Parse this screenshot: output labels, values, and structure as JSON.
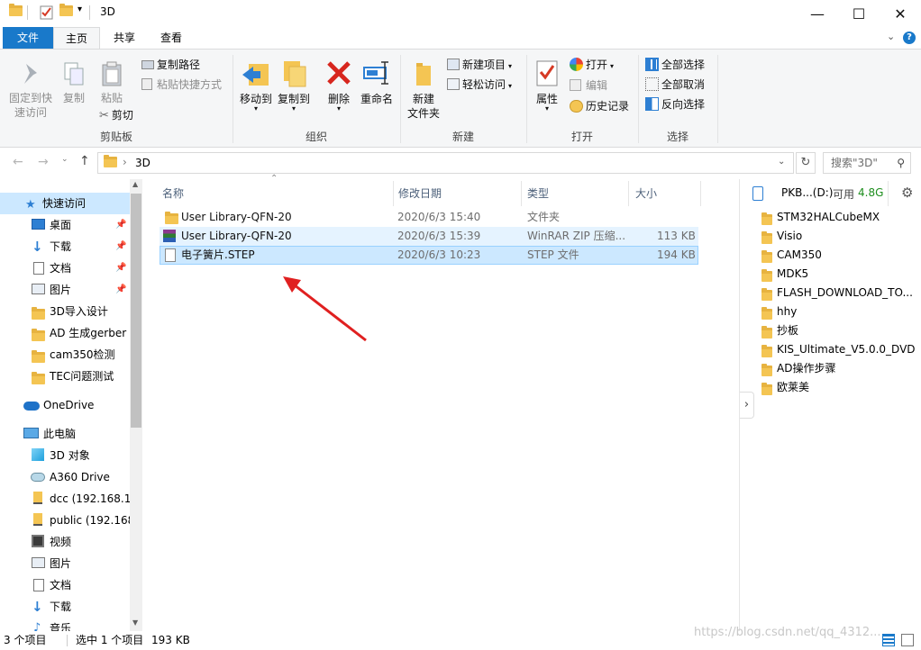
{
  "window": {
    "title": "3D",
    "minimize": "—",
    "maximize": "☐",
    "close": "✕"
  },
  "ribbon_tabs": [
    {
      "label": "文件"
    },
    {
      "label": "主页"
    },
    {
      "label": "共享"
    },
    {
      "label": "查看"
    }
  ],
  "ribbon": {
    "clipboard": {
      "pin_quick": "固定到快\n速访问",
      "copy": "复制",
      "paste": "粘贴",
      "copy_path": "复制路径",
      "paste_shortcut": "粘贴快捷方式",
      "cut": "剪切",
      "label": "剪贴板"
    },
    "organize": {
      "move_to": "移动到",
      "copy_to": "复制到",
      "delete": "删除",
      "rename": "重命名",
      "label": "组织"
    },
    "new": {
      "new_folder": "新建\n文件夹",
      "new_item": "新建项目",
      "easy_access": "轻松访问",
      "label": "新建"
    },
    "open": {
      "properties": "属性",
      "open": "打开",
      "edit": "编辑",
      "history": "历史记录",
      "label": "打开"
    },
    "select": {
      "select_all": "全部选择",
      "select_none": "全部取消",
      "invert": "反向选择",
      "label": "选择"
    }
  },
  "address": {
    "path": "3D",
    "search_placeholder": "搜索\"3D\""
  },
  "nav": {
    "items": [
      {
        "label": "快速访问",
        "icon": "star-icon"
      },
      {
        "label": "桌面",
        "icon": "desktop-icon",
        "pinned": true
      },
      {
        "label": "下载",
        "icon": "download-icon",
        "pinned": true
      },
      {
        "label": "文档",
        "icon": "document-icon",
        "pinned": true
      },
      {
        "label": "图片",
        "icon": "picture-icon",
        "pinned": true
      },
      {
        "label": "3D导入设计",
        "icon": "folder-icon"
      },
      {
        "label": "AD 生成gerber",
        "icon": "folder-icon"
      },
      {
        "label": "cam350检测",
        "icon": "folder-icon"
      },
      {
        "label": "TEC问题测试",
        "icon": "folder-icon"
      },
      {
        "label": "OneDrive",
        "icon": "cloud-icon"
      },
      {
        "label": "此电脑",
        "icon": "computer-icon"
      },
      {
        "label": "3D 对象",
        "icon": "cube-icon"
      },
      {
        "label": "A360 Drive",
        "icon": "drive-icon"
      },
      {
        "label": "dcc (192.168.1.",
        "icon": "network-folder-icon"
      },
      {
        "label": "public (192.168",
        "icon": "network-folder-icon"
      },
      {
        "label": "视频",
        "icon": "video-icon"
      },
      {
        "label": "图片",
        "icon": "picture-icon"
      },
      {
        "label": "文档",
        "icon": "document-icon"
      },
      {
        "label": "下载",
        "icon": "download-icon"
      },
      {
        "label": "音乐",
        "icon": "music-icon"
      }
    ]
  },
  "columns": {
    "name": "名称",
    "date": "修改日期",
    "type": "类型",
    "size": "大小"
  },
  "files": [
    {
      "name": "User Library-QFN-20",
      "date": "2020/6/3 15:40",
      "type": "文件夹",
      "size": "",
      "icon": "folder-icon"
    },
    {
      "name": "User Library-QFN-20",
      "date": "2020/6/3 15:39",
      "type": "WinRAR ZIP 压缩...",
      "size": "113 KB",
      "icon": "winrar-icon"
    },
    {
      "name": "电子簧片.STEP",
      "date": "2020/6/3 10:23",
      "type": "STEP 文件",
      "size": "194 KB",
      "icon": "file-icon"
    }
  ],
  "preview": {
    "drive_label": "PKB...(D:)",
    "available_label": "可用",
    "available_value": "4.8G",
    "items": [
      "STM32HALCubeMX",
      "Visio",
      "CAM350",
      "MDK5",
      "FLASH_DOWNLOAD_TO...",
      "hhy",
      "抄板",
      "KIS_Ultimate_V5.0.0_DVD",
      "AD操作步骤",
      "欧莱美"
    ]
  },
  "status": {
    "count": "3 个项目",
    "selected": "选中 1 个项目",
    "size": "193 KB"
  },
  "watermark": "https://blog.csdn.net/qq_4312...",
  "colors": {
    "accent": "#1979ca",
    "selection": "#cce8ff",
    "arrow": "#e02020"
  }
}
